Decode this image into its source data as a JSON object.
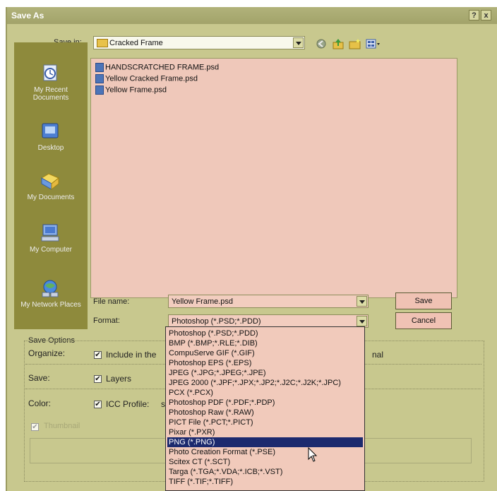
{
  "dialog": {
    "title": "Save As",
    "help_label": "?",
    "close_label": "x"
  },
  "save_in": {
    "label": "Save in:",
    "value": "Cracked Frame"
  },
  "toolbar_icons": [
    "back-icon",
    "up-folder-icon",
    "new-folder-icon",
    "view-menu-icon"
  ],
  "places": [
    {
      "label": "My Recent Documents",
      "icon": "recent-documents-icon"
    },
    {
      "label": "Desktop",
      "icon": "desktop-icon"
    },
    {
      "label": "My Documents",
      "icon": "my-documents-icon"
    },
    {
      "label": "My Computer",
      "icon": "my-computer-icon"
    },
    {
      "label": "My Network Places",
      "icon": "network-places-icon"
    }
  ],
  "files": [
    "HANDSCRATCHED FRAME.psd",
    "Yellow Cracked Frame.psd",
    "Yellow Frame.psd"
  ],
  "file_name": {
    "label": "File name:",
    "value": "Yellow Frame.psd"
  },
  "format": {
    "label": "Format:",
    "value": "Photoshop (*.PSD;*.PDD)",
    "options": [
      "Photoshop (*.PSD;*.PDD)",
      "BMP (*.BMP;*.RLE;*.DIB)",
      "CompuServe GIF (*.GIF)",
      "Photoshop EPS (*.EPS)",
      "JPEG (*.JPG;*.JPEG;*.JPE)",
      "JPEG 2000 (*.JPF;*.JPX;*.JP2;*.J2C;*.J2K;*.JPC)",
      "PCX (*.PCX)",
      "Photoshop PDF (*.PDF;*.PDP)",
      "Photoshop Raw (*.RAW)",
      "PICT File (*.PCT;*.PICT)",
      "Pixar (*.PXR)",
      "PNG (*.PNG)",
      "Photo Creation Format (*.PSE)",
      "Scitex CT (*.SCT)",
      "Targa (*.TGA;*.VDA;*.ICB;*.VST)",
      "TIFF (*.TIF;*.TIFF)"
    ],
    "highlighted": "PNG (*.PNG)"
  },
  "buttons": {
    "save": "Save",
    "cancel": "Cancel"
  },
  "save_options": {
    "title": "Save Options",
    "organize_label": "Organize:",
    "organize_option": "Include in the",
    "organize_tail": "nal",
    "save_label": "Save:",
    "layers_option": "Layers",
    "color_label": "Color:",
    "icc_option": "ICC Profile:",
    "icc_tail": "s",
    "thumbnail_option": "Thumbnail"
  },
  "colors": {
    "dialog_bg": "#c8c88e",
    "places_bg": "#8e8a3c",
    "list_bg": "#efc8ba",
    "selection": "#1c2a6e"
  }
}
